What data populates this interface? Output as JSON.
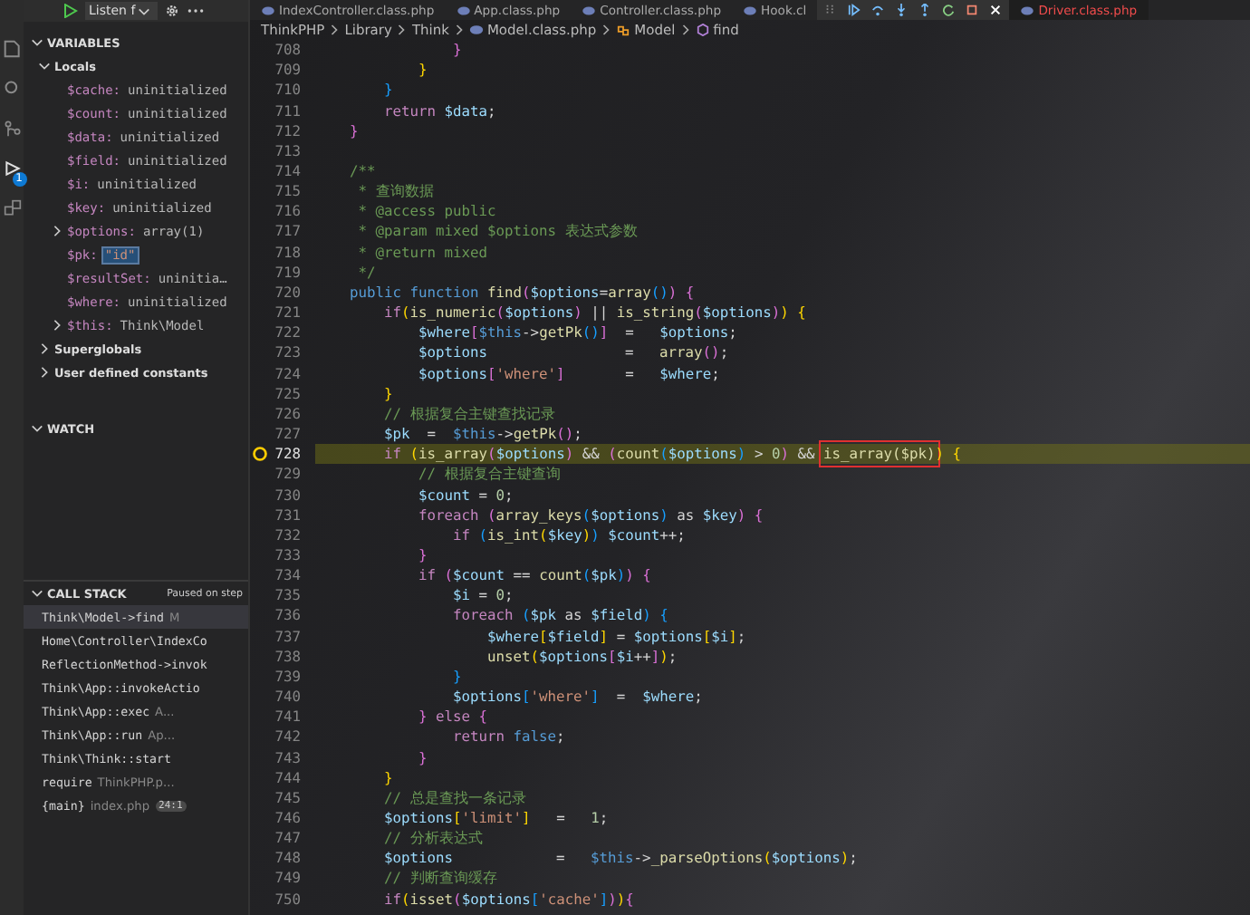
{
  "activity_bar": {
    "badge": "1"
  },
  "debug_header": {
    "config": "Listen f"
  },
  "variables": {
    "title": "VARIABLES",
    "expanded": true,
    "scopes": [
      {
        "name": "Locals",
        "expanded": true,
        "items": [
          {
            "name": "$cache:",
            "value": "uninitialized",
            "expandable": false,
            "selected": false
          },
          {
            "name": "$count:",
            "value": "uninitialized",
            "expandable": false,
            "selected": false
          },
          {
            "name": "$data:",
            "value": "uninitialized",
            "expandable": false,
            "selected": false
          },
          {
            "name": "$field:",
            "value": "uninitialized",
            "expandable": false,
            "selected": false
          },
          {
            "name": "$i:",
            "value": "uninitialized",
            "expandable": false,
            "selected": false
          },
          {
            "name": "$key:",
            "value": "uninitialized",
            "expandable": false,
            "selected": false
          },
          {
            "name": "$options:",
            "value": "array(1)",
            "expandable": true,
            "selected": false
          },
          {
            "name": "$pk:",
            "value": "\"id\"",
            "expandable": false,
            "selected": true
          },
          {
            "name": "$resultSet:",
            "value": "uninitia…",
            "expandable": false,
            "selected": false
          },
          {
            "name": "$where:",
            "value": "uninitialized",
            "expandable": false,
            "selected": false
          },
          {
            "name": "$this:",
            "value": "Think\\Model",
            "expandable": true,
            "selected": false
          }
        ]
      },
      {
        "name": "Superglobals",
        "expanded": false
      },
      {
        "name": "User defined constants",
        "expanded": false
      }
    ]
  },
  "watch": {
    "title": "WATCH",
    "expanded": true
  },
  "call_stack": {
    "title": "CALL STACK",
    "status": "Paused on step",
    "frames": [
      {
        "name": "Think\\Model->find",
        "file": "M",
        "selected": true
      },
      {
        "name": "Home\\Controller\\IndexCo",
        "selected": false
      },
      {
        "name": "ReflectionMethod->invok",
        "selected": false
      },
      {
        "name": "Think\\App::invokeActio",
        "selected": false
      },
      {
        "name": "Think\\App::exec",
        "file": "A...",
        "selected": false
      },
      {
        "name": "Think\\App::run",
        "file": "Ap...",
        "selected": false
      },
      {
        "name": "Think\\Think::start",
        "selected": false
      },
      {
        "name": "require",
        "file": "ThinkPHP.p...",
        "selected": false
      },
      {
        "name": "{main}",
        "file": "index.php",
        "badge": "24:1",
        "selected": false
      }
    ]
  },
  "tabs": [
    {
      "label": "IndexController.class.php",
      "error": false
    },
    {
      "label": "App.class.php",
      "error": false
    },
    {
      "label": "Controller.class.php",
      "error": false
    },
    {
      "label": "Hook.cl",
      "error": false
    },
    {
      "label": "Driver.class.php",
      "error": true
    }
  ],
  "breadcrumb": [
    {
      "label": "ThinkPHP",
      "kind": "folder"
    },
    {
      "label": "Library",
      "kind": "folder"
    },
    {
      "label": "Think",
      "kind": "folder"
    },
    {
      "label": "Model.class.php",
      "kind": "file"
    },
    {
      "label": "Model",
      "kind": "class"
    },
    {
      "label": "find",
      "kind": "method"
    }
  ],
  "code_lines": [
    {
      "n": "708",
      "current": false,
      "tokens": [
        {
          "kind": "bracket2",
          "text": "                }"
        }
      ]
    },
    {
      "n": "709",
      "current": false,
      "tokens": [
        {
          "kind": "bracket1",
          "text": "            }"
        }
      ]
    },
    {
      "n": "710",
      "current": false,
      "tokens": [
        {
          "kind": "bracket3",
          "text": "        }"
        }
      ]
    },
    {
      "n": "711",
      "current": false,
      "tokens": [
        {
          "kind": "control",
          "text": "        return "
        },
        {
          "kind": "variable",
          "text": "$data"
        },
        {
          "kind": "plain",
          "text": ";"
        }
      ]
    },
    {
      "n": "712",
      "current": false,
      "tokens": [
        {
          "kind": "bracket2",
          "text": "    }"
        }
      ]
    },
    {
      "n": "713",
      "current": false
    },
    {
      "n": "714",
      "current": false,
      "tokens": [
        {
          "kind": "comment",
          "text": "    /**"
        }
      ]
    },
    {
      "n": "715",
      "current": false,
      "tokens": [
        {
          "kind": "comment",
          "text": "     * 查询数据"
        }
      ]
    },
    {
      "n": "716",
      "current": false,
      "tokens": [
        {
          "kind": "comment",
          "text": "     * @access public"
        }
      ]
    },
    {
      "n": "717",
      "current": false,
      "tokens": [
        {
          "kind": "comment",
          "text": "     * @param mixed $options 表达式参数"
        }
      ]
    },
    {
      "n": "718",
      "current": false,
      "tokens": [
        {
          "kind": "comment",
          "text": "     * @return mixed"
        }
      ]
    },
    {
      "n": "719",
      "current": false,
      "tokens": [
        {
          "kind": "comment",
          "text": "     */"
        }
      ]
    },
    {
      "n": "720",
      "current": false,
      "tokens": [
        {
          "kind": "keyword",
          "text": "    public function "
        },
        {
          "kind": "function",
          "text": "find"
        },
        {
          "kind": "bracket2",
          "text": "("
        },
        {
          "kind": "variable",
          "text": "$options"
        },
        {
          "kind": "plain",
          "text": "="
        },
        {
          "kind": "function",
          "text": "array"
        },
        {
          "kind": "bracket3",
          "text": "()"
        },
        {
          "kind": "bracket2",
          "text": ") {"
        }
      ]
    },
    {
      "n": "721",
      "current": false,
      "tokens": [
        {
          "kind": "control",
          "text": "        if"
        },
        {
          "kind": "bracket1",
          "text": "("
        },
        {
          "kind": "function",
          "text": "is_numeric"
        },
        {
          "kind": "bracket2",
          "text": "("
        },
        {
          "kind": "variable",
          "text": "$options"
        },
        {
          "kind": "bracket2",
          "text": ")"
        },
        {
          "kind": "plain",
          "text": " || "
        },
        {
          "kind": "function",
          "text": "is_string"
        },
        {
          "kind": "bracket2",
          "text": "("
        },
        {
          "kind": "variable",
          "text": "$options"
        },
        {
          "kind": "bracket2",
          "text": ")"
        },
        {
          "kind": "bracket1",
          "text": ") {"
        }
      ]
    },
    {
      "n": "722",
      "current": false,
      "tokens": [
        {
          "kind": "variable",
          "text": "            $where"
        },
        {
          "kind": "bracket2",
          "text": "["
        },
        {
          "kind": "keyword",
          "text": "$this"
        },
        {
          "kind": "plain",
          "text": "->"
        },
        {
          "kind": "function",
          "text": "getPk"
        },
        {
          "kind": "bracket3",
          "text": "()"
        },
        {
          "kind": "bracket2",
          "text": "]"
        },
        {
          "kind": "plain",
          "text": "  =   "
        },
        {
          "kind": "variable",
          "text": "$options"
        },
        {
          "kind": "plain",
          "text": ";"
        }
      ]
    },
    {
      "n": "723",
      "current": false,
      "tokens": [
        {
          "kind": "variable",
          "text": "            $options"
        },
        {
          "kind": "plain",
          "text": "                =   "
        },
        {
          "kind": "function",
          "text": "array"
        },
        {
          "kind": "bracket2",
          "text": "()"
        },
        {
          "kind": "plain",
          "text": ";"
        }
      ]
    },
    {
      "n": "724",
      "current": false,
      "tokens": [
        {
          "kind": "variable",
          "text": "            $options"
        },
        {
          "kind": "bracket2",
          "text": "["
        },
        {
          "kind": "string",
          "text": "'where'"
        },
        {
          "kind": "bracket2",
          "text": "]"
        },
        {
          "kind": "plain",
          "text": "       =   "
        },
        {
          "kind": "variable",
          "text": "$where"
        },
        {
          "kind": "plain",
          "text": ";"
        }
      ]
    },
    {
      "n": "725",
      "current": false,
      "tokens": [
        {
          "kind": "bracket1",
          "text": "        }"
        }
      ]
    },
    {
      "n": "726",
      "current": false,
      "tokens": [
        {
          "kind": "comment",
          "text": "        // 根据复合主键查找记录"
        }
      ]
    },
    {
      "n": "727",
      "current": false,
      "tokens": [
        {
          "kind": "variable",
          "text": "        $pk"
        },
        {
          "kind": "plain",
          "text": "  =  "
        },
        {
          "kind": "keyword",
          "text": "$this"
        },
        {
          "kind": "plain",
          "text": "->"
        },
        {
          "kind": "function",
          "text": "getPk"
        },
        {
          "kind": "bracket2",
          "text": "()"
        },
        {
          "kind": "plain",
          "text": ";"
        }
      ]
    },
    {
      "n": "728",
      "current": true,
      "tokens": [
        {
          "kind": "control",
          "text": "        if "
        },
        {
          "kind": "bracket1",
          "text": "("
        },
        {
          "kind": "function",
          "text": "is_array"
        },
        {
          "kind": "bracket2",
          "text": "("
        },
        {
          "kind": "variable",
          "text": "$options"
        },
        {
          "kind": "bracket2",
          "text": ")"
        },
        {
          "kind": "plain",
          "text": " && "
        },
        {
          "kind": "bracket2",
          "text": "("
        },
        {
          "kind": "function",
          "text": "count"
        },
        {
          "kind": "bracket3",
          "text": "("
        },
        {
          "kind": "variable",
          "text": "$options"
        },
        {
          "kind": "bracket3",
          "text": ")"
        },
        {
          "kind": "plain",
          "text": " > "
        },
        {
          "kind": "number",
          "text": "0"
        },
        {
          "kind": "bracket2",
          "text": ")"
        },
        {
          "kind": "plain",
          "text": " && "
        },
        {
          "kind": "boxed",
          "text": "is_array($pk)"
        },
        {
          "kind": "bracket1",
          "text": ") {"
        }
      ]
    },
    {
      "n": "729",
      "current": false,
      "tokens": [
        {
          "kind": "comment",
          "text": "            // 根据复合主键查询"
        }
      ]
    },
    {
      "n": "730",
      "current": false,
      "tokens": [
        {
          "kind": "variable",
          "text": "            $count"
        },
        {
          "kind": "plain",
          "text": " = "
        },
        {
          "kind": "number",
          "text": "0"
        },
        {
          "kind": "plain",
          "text": ";"
        }
      ]
    },
    {
      "n": "731",
      "current": false,
      "tokens": [
        {
          "kind": "control",
          "text": "            foreach "
        },
        {
          "kind": "bracket2",
          "text": "("
        },
        {
          "kind": "function",
          "text": "array_keys"
        },
        {
          "kind": "bracket3",
          "text": "("
        },
        {
          "kind": "variable",
          "text": "$options"
        },
        {
          "kind": "bracket3",
          "text": ")"
        },
        {
          "kind": "plain",
          "text": " as "
        },
        {
          "kind": "variable",
          "text": "$key"
        },
        {
          "kind": "bracket2",
          "text": ") {"
        }
      ]
    },
    {
      "n": "732",
      "current": false,
      "tokens": [
        {
          "kind": "control",
          "text": "                if "
        },
        {
          "kind": "bracket3",
          "text": "("
        },
        {
          "kind": "function",
          "text": "is_int"
        },
        {
          "kind": "bracket1",
          "text": "("
        },
        {
          "kind": "variable",
          "text": "$key"
        },
        {
          "kind": "bracket1",
          "text": ")"
        },
        {
          "kind": "bracket3",
          "text": ")"
        },
        {
          "kind": "variable",
          "text": " $count"
        },
        {
          "kind": "plain",
          "text": "++;"
        }
      ]
    },
    {
      "n": "733",
      "current": false,
      "tokens": [
        {
          "kind": "bracket2",
          "text": "            }"
        }
      ]
    },
    {
      "n": "734",
      "current": false,
      "tokens": [
        {
          "kind": "control",
          "text": "            if "
        },
        {
          "kind": "bracket2",
          "text": "("
        },
        {
          "kind": "variable",
          "text": "$count"
        },
        {
          "kind": "plain",
          "text": " == "
        },
        {
          "kind": "function",
          "text": "count"
        },
        {
          "kind": "bracket3",
          "text": "("
        },
        {
          "kind": "variable",
          "text": "$pk"
        },
        {
          "kind": "bracket3",
          "text": ")"
        },
        {
          "kind": "bracket2",
          "text": ") {"
        }
      ]
    },
    {
      "n": "735",
      "current": false,
      "tokens": [
        {
          "kind": "variable",
          "text": "                $i"
        },
        {
          "kind": "plain",
          "text": " = "
        },
        {
          "kind": "number",
          "text": "0"
        },
        {
          "kind": "plain",
          "text": ";"
        }
      ]
    },
    {
      "n": "736",
      "current": false,
      "tokens": [
        {
          "kind": "control",
          "text": "                foreach "
        },
        {
          "kind": "bracket3",
          "text": "("
        },
        {
          "kind": "variable",
          "text": "$pk"
        },
        {
          "kind": "plain",
          "text": " as "
        },
        {
          "kind": "variable",
          "text": "$field"
        },
        {
          "kind": "bracket3",
          "text": ") {"
        }
      ]
    },
    {
      "n": "737",
      "current": false,
      "tokens": [
        {
          "kind": "variable",
          "text": "                    $where"
        },
        {
          "kind": "bracket1",
          "text": "["
        },
        {
          "kind": "variable",
          "text": "$field"
        },
        {
          "kind": "bracket1",
          "text": "]"
        },
        {
          "kind": "plain",
          "text": " = "
        },
        {
          "kind": "variable",
          "text": "$options"
        },
        {
          "kind": "bracket1",
          "text": "["
        },
        {
          "kind": "variable",
          "text": "$i"
        },
        {
          "kind": "bracket1",
          "text": "]"
        },
        {
          "kind": "plain",
          "text": ";"
        }
      ]
    },
    {
      "n": "738",
      "current": false,
      "tokens": [
        {
          "kind": "function",
          "text": "                    unset"
        },
        {
          "kind": "bracket1",
          "text": "("
        },
        {
          "kind": "variable",
          "text": "$options"
        },
        {
          "kind": "bracket2",
          "text": "["
        },
        {
          "kind": "variable",
          "text": "$i"
        },
        {
          "kind": "plain",
          "text": "++"
        },
        {
          "kind": "bracket2",
          "text": "]"
        },
        {
          "kind": "bracket1",
          "text": ")"
        },
        {
          "kind": "plain",
          "text": ";"
        }
      ]
    },
    {
      "n": "739",
      "current": false,
      "tokens": [
        {
          "kind": "bracket3",
          "text": "                }"
        }
      ]
    },
    {
      "n": "740",
      "current": false,
      "tokens": [
        {
          "kind": "variable",
          "text": "                $options"
        },
        {
          "kind": "bracket3",
          "text": "["
        },
        {
          "kind": "string",
          "text": "'where'"
        },
        {
          "kind": "bracket3",
          "text": "]"
        },
        {
          "kind": "plain",
          "text": "  =  "
        },
        {
          "kind": "variable",
          "text": "$where"
        },
        {
          "kind": "plain",
          "text": ";"
        }
      ]
    },
    {
      "n": "741",
      "current": false,
      "tokens": [
        {
          "kind": "bracket2",
          "text": "            }"
        },
        {
          "kind": "control",
          "text": " else "
        },
        {
          "kind": "bracket2",
          "text": "{"
        }
      ]
    },
    {
      "n": "742",
      "current": false,
      "tokens": [
        {
          "kind": "control",
          "text": "                return "
        },
        {
          "kind": "keyword",
          "text": "false"
        },
        {
          "kind": "plain",
          "text": ";"
        }
      ]
    },
    {
      "n": "743",
      "current": false,
      "tokens": [
        {
          "kind": "bracket2",
          "text": "            }"
        }
      ]
    },
    {
      "n": "744",
      "current": false,
      "tokens": [
        {
          "kind": "bracket1",
          "text": "        }"
        }
      ]
    },
    {
      "n": "745",
      "current": false,
      "tokens": [
        {
          "kind": "comment",
          "text": "        // 总是查找一条记录"
        }
      ]
    },
    {
      "n": "746",
      "current": false,
      "tokens": [
        {
          "kind": "variable",
          "text": "        $options"
        },
        {
          "kind": "bracket1",
          "text": "["
        },
        {
          "kind": "string",
          "text": "'limit'"
        },
        {
          "kind": "bracket1",
          "text": "]"
        },
        {
          "kind": "plain",
          "text": "   =   "
        },
        {
          "kind": "number",
          "text": "1"
        },
        {
          "kind": "plain",
          "text": ";"
        }
      ]
    },
    {
      "n": "747",
      "current": false,
      "tokens": [
        {
          "kind": "comment",
          "text": "        // 分析表达式"
        }
      ]
    },
    {
      "n": "748",
      "current": false,
      "tokens": [
        {
          "kind": "variable",
          "text": "        $options"
        },
        {
          "kind": "plain",
          "text": "            =   "
        },
        {
          "kind": "keyword",
          "text": "$this"
        },
        {
          "kind": "plain",
          "text": "->"
        },
        {
          "kind": "function",
          "text": "_parseOptions"
        },
        {
          "kind": "bracket1",
          "text": "("
        },
        {
          "kind": "variable",
          "text": "$options"
        },
        {
          "kind": "bracket1",
          "text": ")"
        },
        {
          "kind": "plain",
          "text": ";"
        }
      ]
    },
    {
      "n": "749",
      "current": false,
      "tokens": [
        {
          "kind": "comment",
          "text": "        // 判断查询缓存"
        }
      ]
    },
    {
      "n": "750",
      "current": false,
      "tokens": [
        {
          "kind": "control",
          "text": "        if"
        },
        {
          "kind": "bracket1",
          "text": "("
        },
        {
          "kind": "function",
          "text": "isset"
        },
        {
          "kind": "bracket2",
          "text": "("
        },
        {
          "kind": "variable",
          "text": "$options"
        },
        {
          "kind": "bracket3",
          "text": "["
        },
        {
          "kind": "string",
          "text": "'cache'"
        },
        {
          "kind": "bracket3",
          "text": "]"
        },
        {
          "kind": "bracket2",
          "text": ")"
        },
        {
          "kind": "bracket1",
          "text": ")"
        },
        {
          "kind": "bracket2",
          "text": "{"
        }
      ]
    }
  ]
}
